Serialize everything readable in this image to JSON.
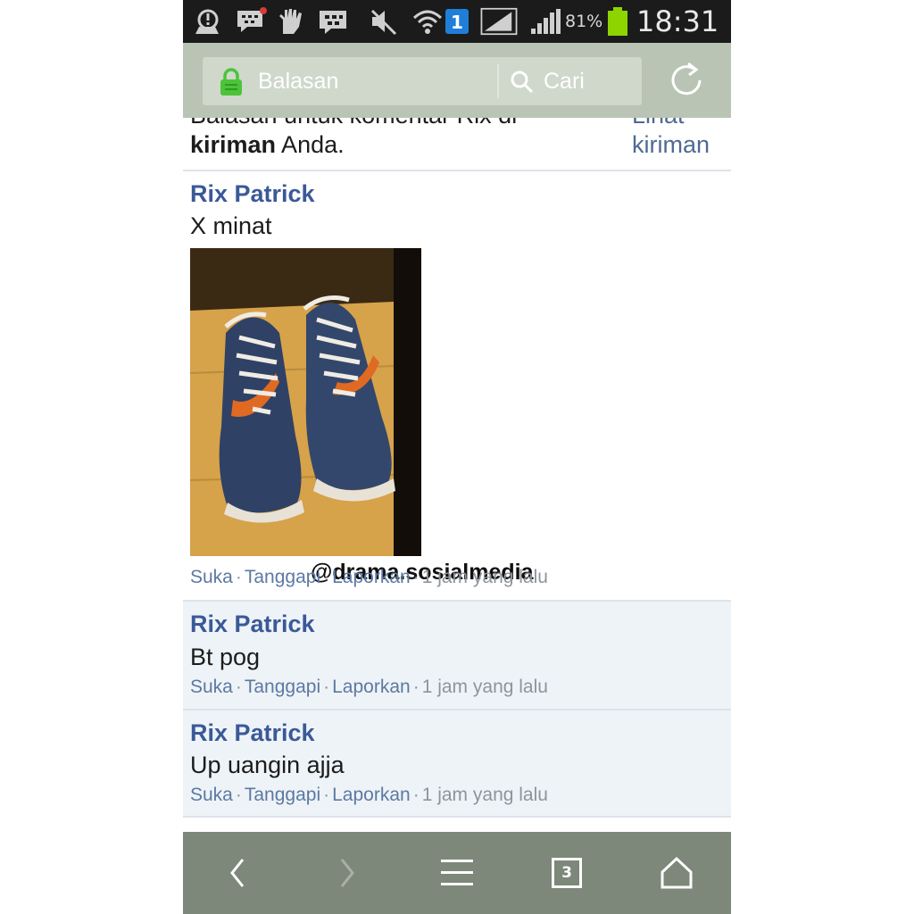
{
  "status_bar": {
    "battery_percent": "81%",
    "time": "18:31",
    "network_badge": "1",
    "icons": [
      "notification-icon",
      "bbm-message-icon",
      "hand-icon",
      "bbm-icon",
      "mute-icon",
      "wifi-icon",
      "sim-badge-icon",
      "signal-icon",
      "signal-icon",
      "battery-icon"
    ]
  },
  "toolbar": {
    "address_text": "Balasan",
    "search_text": "Cari",
    "icons": [
      "lock-icon",
      "search-icon",
      "refresh-icon"
    ]
  },
  "notification": {
    "line1": "Balasan untuk komentar Rix di",
    "line2_bold": "kiriman",
    "line2_rest": " Anda.",
    "view_post_line1": "Lihat",
    "view_post_line2": "kiriman"
  },
  "comments": [
    {
      "author": "Rix Patrick",
      "message": "X minat",
      "actions": {
        "like": "Suka",
        "reply": "Tanggapi",
        "report": "Laporkan"
      },
      "time": "1 jam yang lalu"
    },
    {
      "author": "Rix Patrick",
      "message": "Bt pog",
      "actions": {
        "like": "Suka",
        "reply": "Tanggapi",
        "report": "Laporkan"
      },
      "time": "1 jam yang lalu"
    },
    {
      "author": "Rix Patrick",
      "message": "Up uangin ajja",
      "actions": {
        "like": "Suka",
        "reply": "Tanggapi",
        "report": "Laporkan"
      },
      "time": "1 jam yang lalu"
    }
  ],
  "watermark": "@drama.sosialmedia",
  "bottom_nav": {
    "tabs_count": "3",
    "icons": [
      "back-icon",
      "forward-icon",
      "menu-icon",
      "tabs-icon",
      "home-icon"
    ]
  },
  "colors": {
    "status_bar": "#1b1b1b",
    "toolbar": "#b9c4b4",
    "link_blue": "#3b5998",
    "alt_row": "#eef3f7",
    "bottom_nav": "#7d877a",
    "battery_green": "#8ed400"
  }
}
